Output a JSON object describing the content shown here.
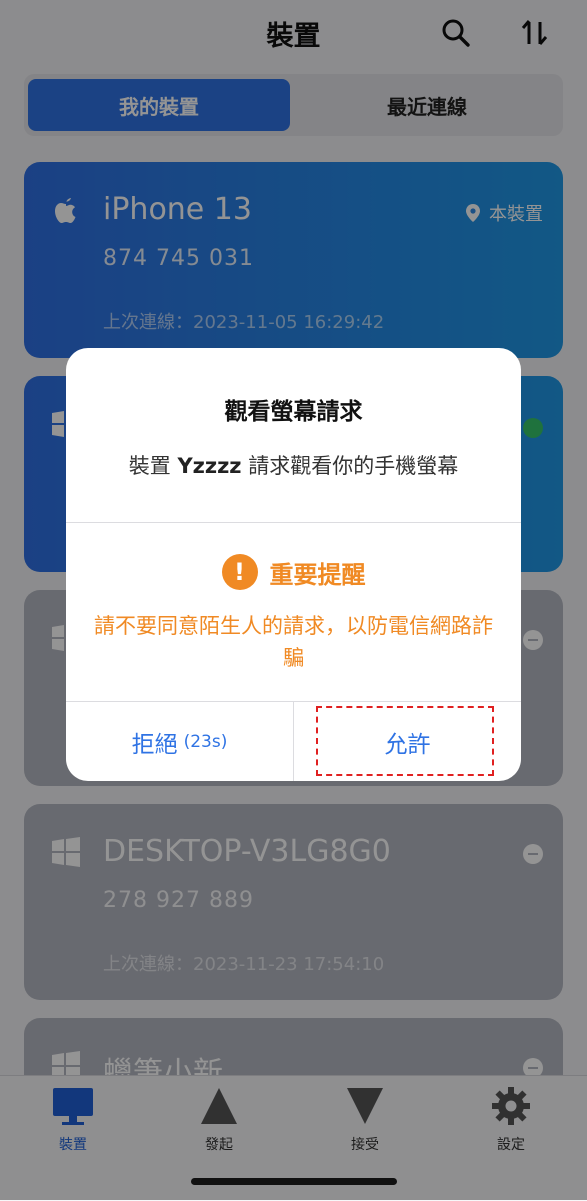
{
  "header": {
    "title": "裝置",
    "search_icon": "search-icon",
    "sort_icon": "sort-icon"
  },
  "segments": {
    "my_devices": "我的裝置",
    "recent": "最近連線"
  },
  "devices": [
    {
      "name": "iPhone 13",
      "id": "874 745 031",
      "last_conn": "上次連線：2023-11-05 16:29:42",
      "badge": "本裝置",
      "os": "apple"
    },
    {
      "name": "",
      "id": "",
      "last_conn": "",
      "os": "windows",
      "status": "online"
    },
    {
      "name": "",
      "id": "",
      "last_conn": "",
      "os": "windows"
    },
    {
      "name": "DESKTOP-V3LG8G0",
      "id": "278 927 889",
      "last_conn": "上次連線：2023-11-23 17:54:10",
      "os": "windows"
    },
    {
      "name": "蠟筆小新",
      "os": "windows"
    }
  ],
  "dialog": {
    "title": "觀看螢幕請求",
    "msg_prefix": "裝置 ",
    "device_name": "Yzzzz",
    "msg_suffix": " 請求觀看你的手機螢幕",
    "warning_title": "重要提醒",
    "warning_text": "請不要同意陌生人的請求，以防電信網路詐騙",
    "reject_label": "拒絕",
    "countdown": "(23s)",
    "allow_label": "允許"
  },
  "tabbar": {
    "devices": "裝置",
    "initiate": "發起",
    "accept": "接受",
    "settings": "設定"
  },
  "colors": {
    "accent": "#2f73e4",
    "warning": "#f08a24",
    "highlight": "#e02020"
  }
}
